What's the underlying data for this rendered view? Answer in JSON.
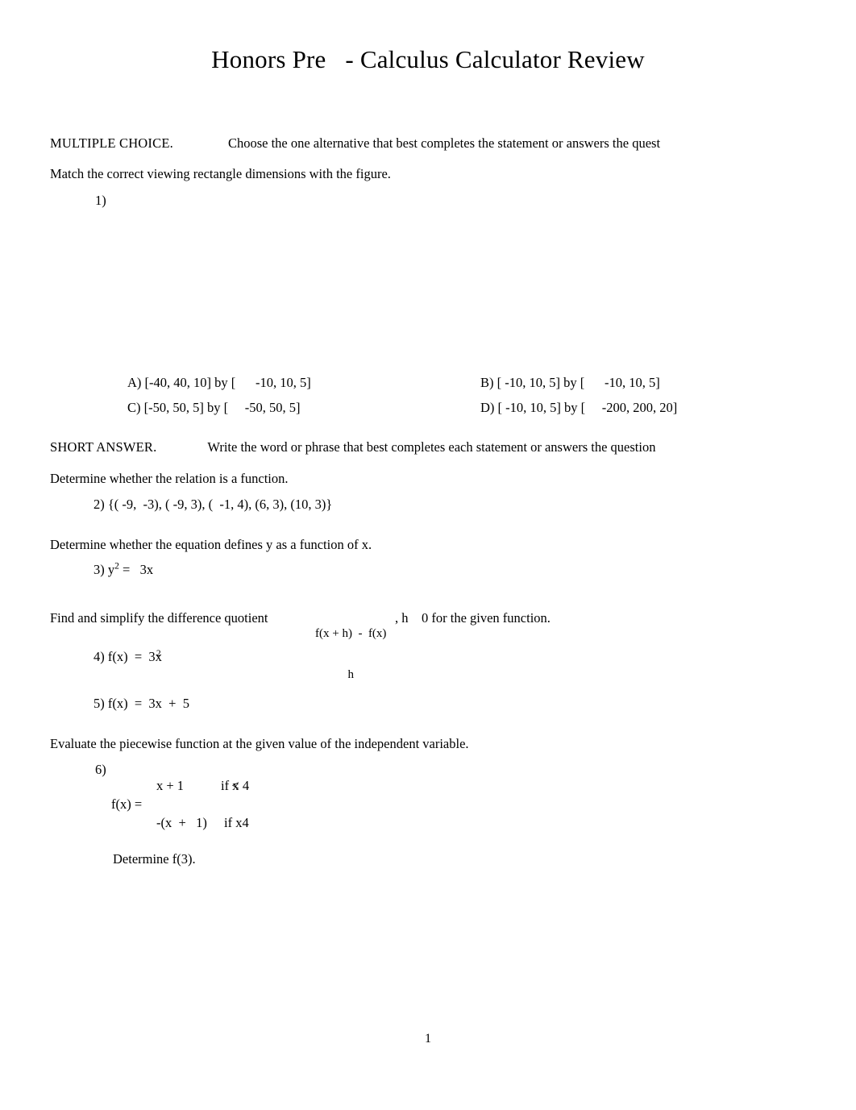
{
  "document": {
    "title": "Honors Pre   - Calculus Calculator Review",
    "page_number": "1"
  },
  "sections": [
    {
      "label": "MULTIPLE CHOICE.",
      "instruction": "Choose the one alternative that best completes the statement or answers the quest"
    },
    {
      "label": "SHORT ANSWER.",
      "instruction": "Write the word or phrase that best completes each statement or answers the question"
    }
  ],
  "directions": {
    "match_viewing_rectangle": "Match the correct viewing rectangle dimensions with the figure.",
    "relation_function": "Determine whether the relation is a function.",
    "equation_defines_y": "Determine whether the equation defines y as a function of x.",
    "difference_quotient_prefix": "Find and simplify the difference quotient",
    "difference_quotient_numerator": "f(x + h)  -  f(x)",
    "difference_quotient_denominator": "h",
    "difference_quotient_suffix": ", h    0 for the given function.",
    "piecewise": "Evaluate the piecewise function at the given value of the independent variable."
  },
  "questions": [
    {
      "number": "1)",
      "choices": [
        {
          "letter": "A)",
          "text": " [-40, 40, 10] by [      -10, 10, 5]"
        },
        {
          "letter": "B)",
          "text": " [ -10, 10, 5] by [      -10, 10, 5]"
        },
        {
          "letter": "C)",
          "text": " [-50, 50, 5] by [     -50, 50, 5]"
        },
        {
          "letter": "D)",
          "text": " [ -10, 10, 5] by [     -200, 200, 20]"
        }
      ]
    },
    {
      "number": "2)",
      "text": "{( -9,  -3), ( -9, 3), (  -1, 4), (6, 3), (10, 3)}"
    },
    {
      "number": "3)",
      "lhs": "y",
      "exponent": "2",
      "rhs": " =   3x"
    },
    {
      "number": "4)",
      "lhs": "f(x)  =  3x",
      "exponent": "2"
    },
    {
      "number": "5)",
      "text": "f(x)  =  3x  +  5"
    },
    {
      "number": "6)",
      "piecewise": {
        "fx_label": "f(x) =",
        "branch1_expr": "x + 1",
        "branch1_cond_prefix": "if ",
        "branch1_cond_var": "x",
        "branch1_cond_op": "<",
        "branch1_cond_value": " 4",
        "branch2_expr": "-(x  +   1)",
        "branch2_cond_prefix": "if ",
        "branch2_cond_var": "x",
        "branch2_cond_value": "4"
      },
      "followup": "Determine f(3)."
    }
  ]
}
